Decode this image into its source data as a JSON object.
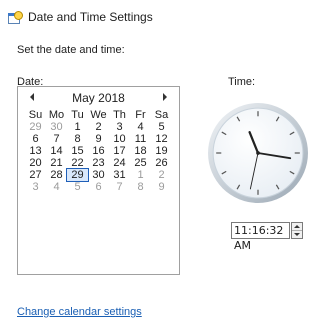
{
  "window": {
    "title": "Date and Time Settings"
  },
  "instructions": "Set the date and time:",
  "date_label": "Date:",
  "time_label": "Time:",
  "calendar": {
    "month_label": "May 2018",
    "weekdays": [
      "Su",
      "Mo",
      "Tu",
      "We",
      "Th",
      "Fr",
      "Sa"
    ],
    "weeks": [
      [
        "29",
        "30",
        "1",
        "2",
        "3",
        "4",
        "5"
      ],
      [
        "6",
        "7",
        "8",
        "9",
        "10",
        "11",
        "12"
      ],
      [
        "13",
        "14",
        "15",
        "16",
        "17",
        "18",
        "19"
      ],
      [
        "20",
        "21",
        "22",
        "23",
        "24",
        "25",
        "26"
      ],
      [
        "27",
        "28",
        "29",
        "30",
        "31",
        "1",
        "2"
      ],
      [
        "3",
        "4",
        "5",
        "6",
        "7",
        "8",
        "9"
      ]
    ],
    "selected_day": "29"
  },
  "time": {
    "value": "11:16:32 AM"
  },
  "link": {
    "text": "Change calendar settings"
  }
}
